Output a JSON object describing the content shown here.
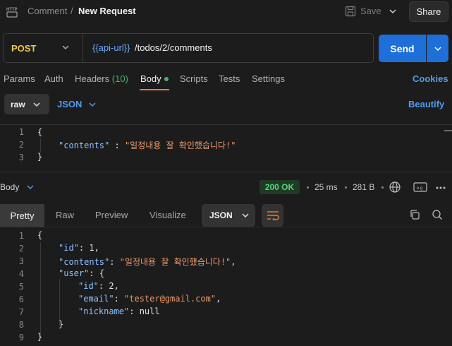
{
  "header": {
    "icon_label": "HTTP",
    "breadcrumb_parent": "Comment",
    "breadcrumb_sep": "/",
    "title": "New Request",
    "save_label": "Save",
    "share_label": "Share"
  },
  "request": {
    "method": "POST",
    "url_variable": "{{api-url}}",
    "url_path": "/todos/2/comments",
    "send_label": "Send"
  },
  "request_tabs": {
    "params": "Params",
    "auth": "Auth",
    "headers": "Headers",
    "headers_count": "(10)",
    "body": "Body",
    "scripts": "Scripts",
    "tests": "Tests",
    "settings": "Settings",
    "cookies": "Cookies"
  },
  "body_options": {
    "mode": "raw",
    "language": "JSON",
    "beautify": "Beautify"
  },
  "request_editor": {
    "lines": [
      {
        "num": "1",
        "text": "{"
      },
      {
        "num": "2",
        "key": "\"contents\"",
        "sep": " : ",
        "value": "\"일정내용 잘 확인했습니다!\""
      },
      {
        "num": "3",
        "text": "}"
      }
    ]
  },
  "response": {
    "section_label": "Body",
    "status": "200 OK",
    "time": "25 ms",
    "size": "281 B",
    "tabs": {
      "pretty": "Pretty",
      "raw": "Raw",
      "preview": "Preview",
      "visualize": "Visualize"
    },
    "format": "JSON",
    "lines": [
      {
        "num": "1",
        "text": "{"
      },
      {
        "num": "2",
        "key": "\"id\"",
        "sep": ": ",
        "value": "1",
        "trail": ","
      },
      {
        "num": "3",
        "key": "\"contents\"",
        "sep": ": ",
        "value": "\"일정내용 잘 확인했습니다!\"",
        "trail": ","
      },
      {
        "num": "4",
        "key": "\"user\"",
        "sep": ": ",
        "value": "{"
      },
      {
        "num": "5",
        "key": "\"id\"",
        "sep": ": ",
        "value": "2",
        "trail": ","
      },
      {
        "num": "6",
        "key": "\"email\"",
        "sep": ": ",
        "value": "\"tester@gmail.com\"",
        "trail": ","
      },
      {
        "num": "7",
        "key": "\"nickname\"",
        "sep": ": ",
        "value": "null"
      },
      {
        "num": "8",
        "text": "}"
      },
      {
        "num": "9",
        "text": "}"
      }
    ]
  },
  "colors": {
    "accent_blue": "#1e6fd9",
    "method_yellow": "#f2c94c",
    "status_green": "#5ad27a",
    "active_tab_orange": "#f27b2b"
  },
  "icons": [
    "http-icon",
    "save-icon",
    "chevron-down-icon",
    "globe-icon",
    "save-response-icon",
    "more-icon",
    "wrap-lines-icon",
    "copy-icon",
    "search-icon"
  ]
}
